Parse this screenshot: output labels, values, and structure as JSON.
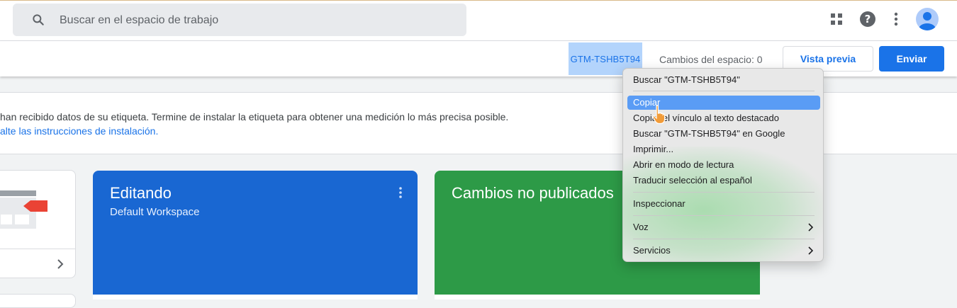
{
  "search": {
    "placeholder": "Buscar en el espacio de trabajo",
    "icon": "search-icon"
  },
  "topbar_icons": [
    "apps-grid-icon",
    "help-icon",
    "more-vert-icon",
    "account-avatar-icon"
  ],
  "header": {
    "container_id": "GTM-TSHB5T94",
    "workspace_changes": "Cambios del espacio: 0",
    "preview_label": "Vista previa",
    "submit_label": "Enviar"
  },
  "notice": {
    "message": "han recibido datos de su etiqueta. Termine de instalar la etiqueta para obtener una medición lo más precisa posible.",
    "link": "alte las instrucciones de instalación."
  },
  "cards": {
    "editing": {
      "title": "Editando",
      "subtitle": "Default Workspace"
    },
    "unpublished": {
      "title": "Cambios no publicados"
    }
  },
  "context_menu": {
    "items": [
      "Buscar \"GTM-TSHB5T94\"",
      "Copiar",
      "Copiar el vínculo al texto destacado",
      "Buscar \"GTM-TSHB5T94\" en Google",
      "Imprimir...",
      "Abrir en modo de lectura",
      "Traducir selección al español",
      "Inspeccionar",
      "Voz",
      "Servicios"
    ],
    "selected": "Copiar"
  },
  "colors": {
    "primary_blue": "#1a73e8",
    "editing_card": "#1967d2",
    "unpublished_card": "#2d9a47",
    "selection_highlight": "#b3d4fc",
    "menu_selected": "#5a9cf5"
  }
}
